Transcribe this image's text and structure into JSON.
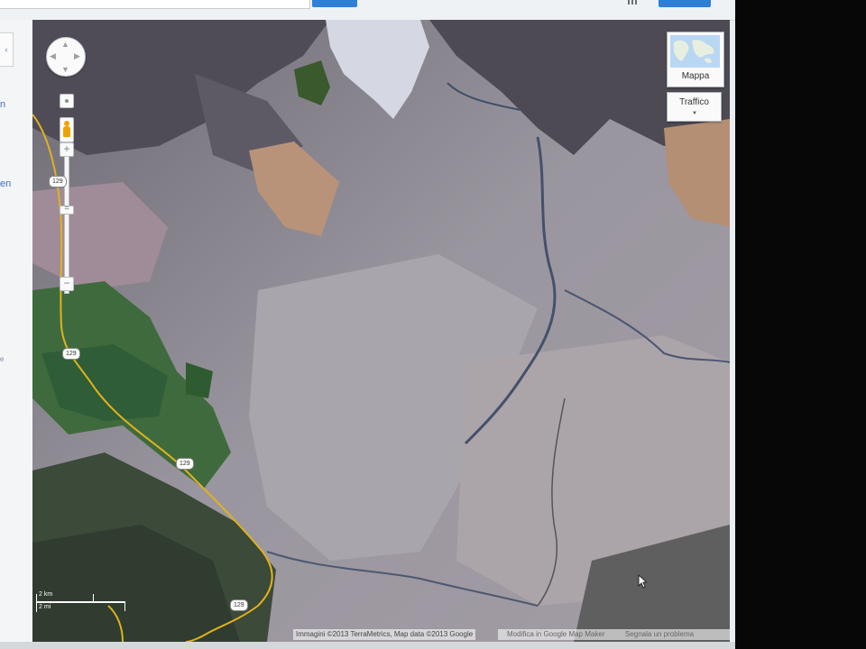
{
  "toolbar": {
    "search_icon": "search-icon",
    "apps_icon": "grid-icon",
    "signin_label": ""
  },
  "left_panel": {
    "collapse_icon": "chevron-icon",
    "collapse_label": "‹",
    "fragments": [
      "n",
      "en",
      "e"
    ]
  },
  "map": {
    "view": "satellite",
    "controls": {
      "pan_icon": "pan-control-icon",
      "pegman_icon": "pegman-icon",
      "zoom_in": "+",
      "zoom_mid": "=",
      "zoom_out": "−"
    },
    "map_type_label": "Mappa",
    "traffic_label": "Traffico",
    "route_shields": [
      "129",
      "129",
      "129",
      "129"
    ],
    "scale": {
      "top": "2 km",
      "bottom": "2 mi"
    },
    "attribution": "Immagini ©2013 TerraMetrics, Map data ©2013 Google",
    "footer_links": [
      "Modifica in Google Map Maker",
      "Segnala un problema"
    ],
    "road_color": "#e0b21c"
  }
}
